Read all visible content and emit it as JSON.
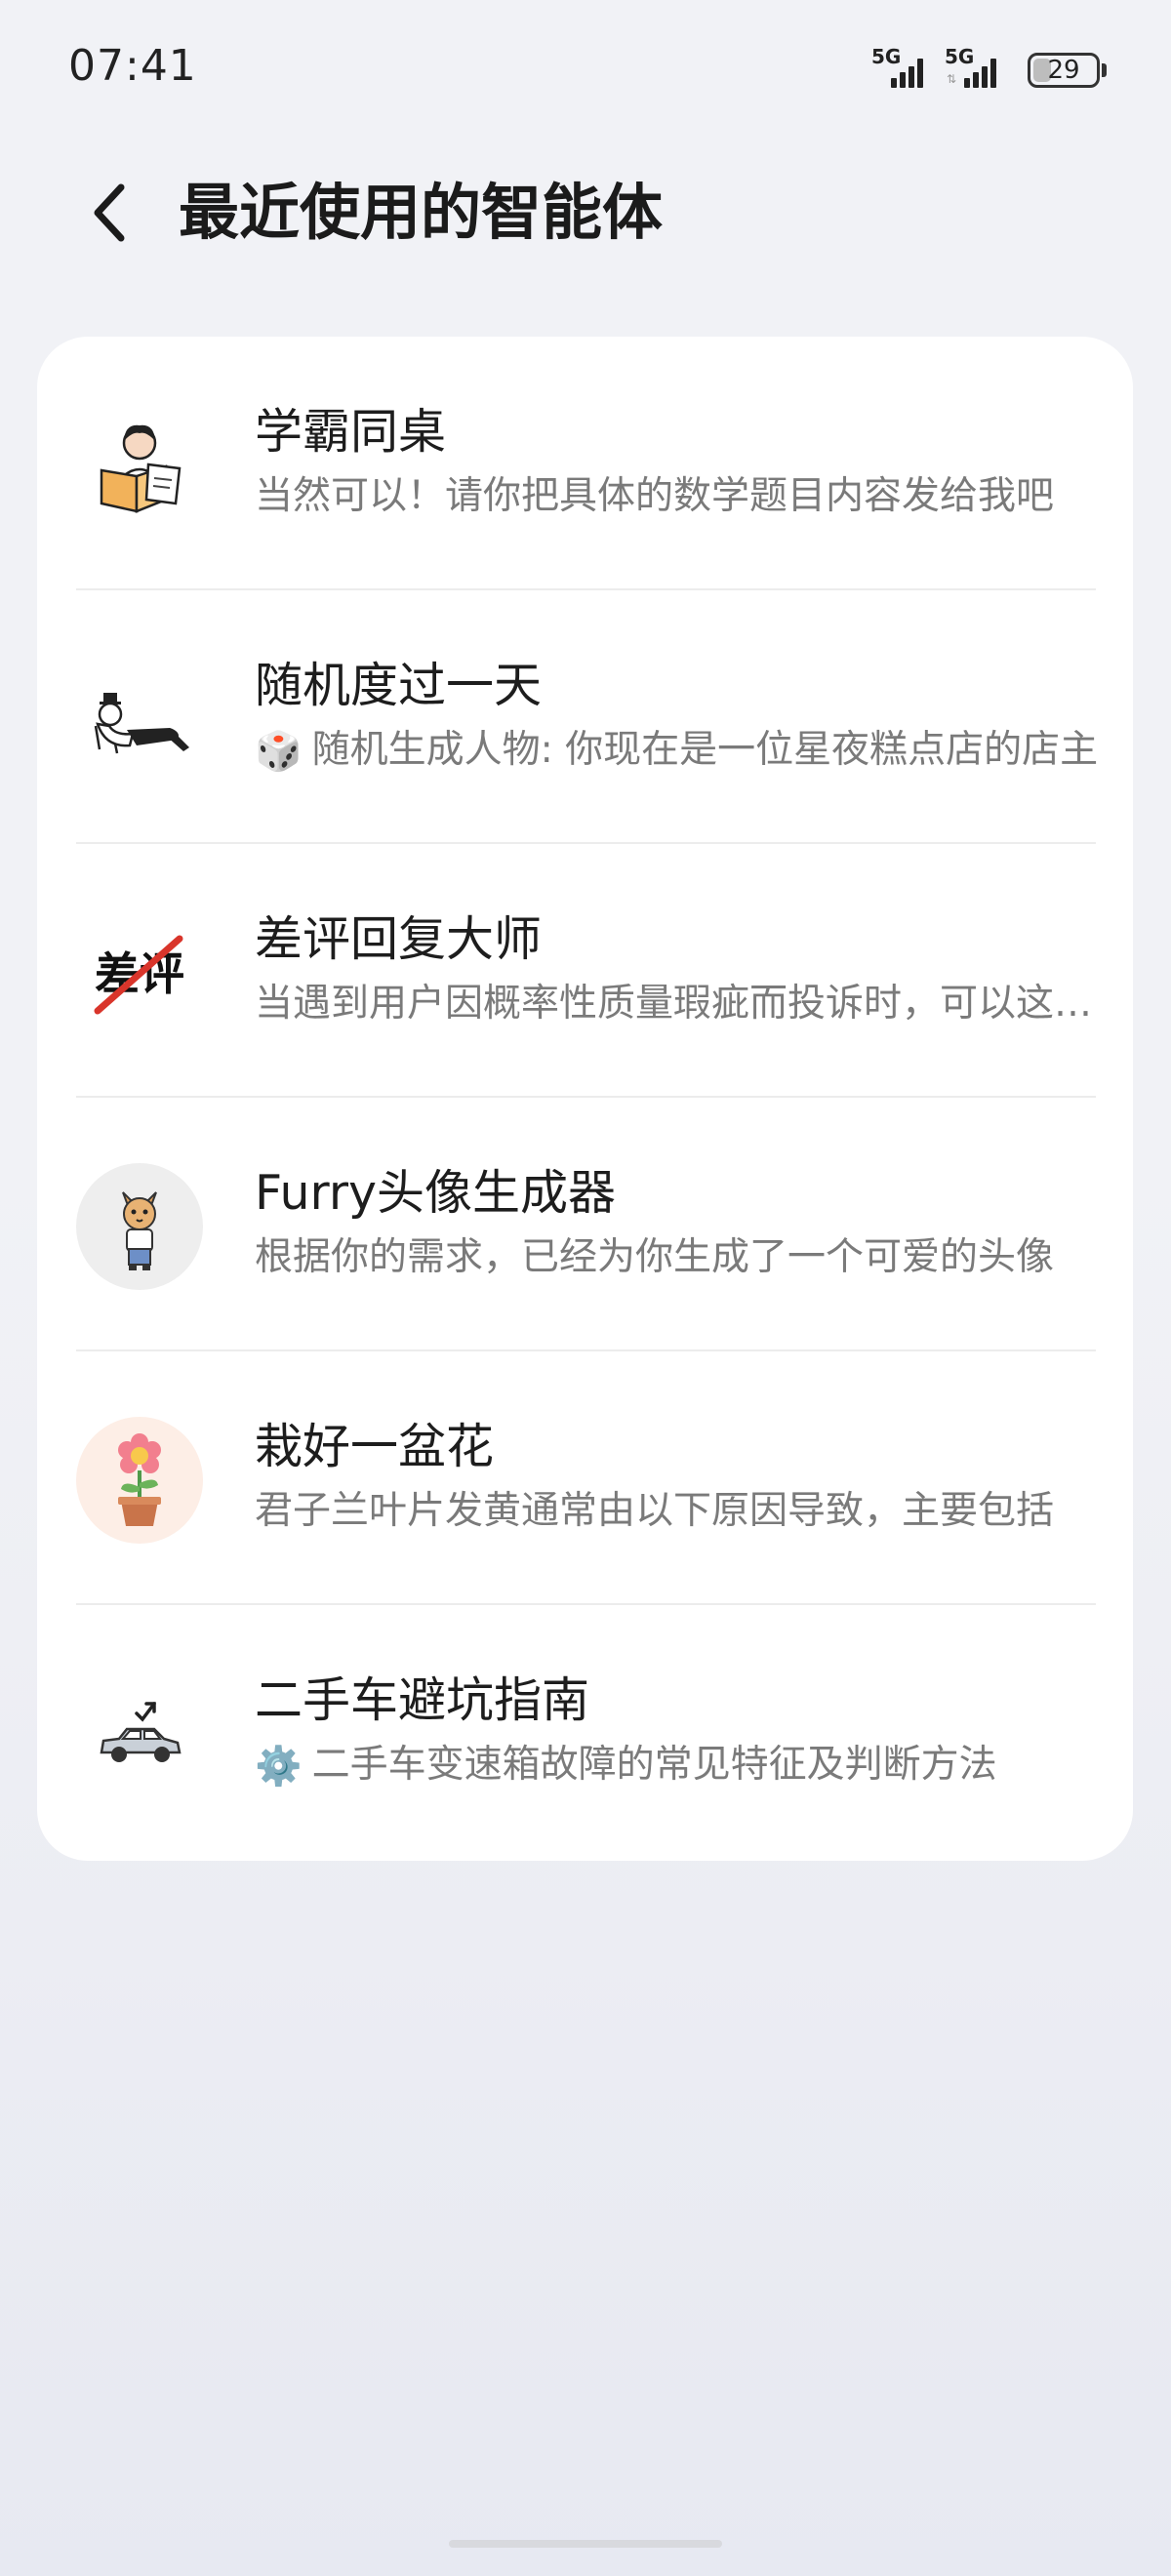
{
  "status_bar": {
    "time": "07:41",
    "signal1_label": "5G",
    "signal2_label": "5G",
    "battery": "29",
    "battery_level": 0.29
  },
  "header": {
    "title": "最近使用的智能体"
  },
  "agents": [
    {
      "name": "学霸同桌",
      "desc": "当然可以！请你把具体的数学题目内容发给我吧",
      "icon": "student-reading-icon"
    },
    {
      "name": "随机度过一天",
      "desc": "随机生成人物: 你现在是一位星夜糕点店的店主",
      "desc_emoji": "🎲",
      "icon": "lying-character-icon"
    },
    {
      "name": "差评回复大师",
      "desc": "当遇到用户因概率性质量瑕疵而投诉时，可以这样回复",
      "icon": "bad-review-icon"
    },
    {
      "name": "Furry头像生成器",
      "desc": "根据你的需求，已经为你生成了一个可爱的头像",
      "icon": "furry-cat-icon"
    },
    {
      "name": "栽好一盆花",
      "desc": "君子兰叶片发黄通常由以下原因导致，主要包括",
      "icon": "flower-pot-icon"
    },
    {
      "name": "二手车避坑指南",
      "desc": "二手车变速箱故障的常见特征及判断方法",
      "desc_emoji": "⚙️",
      "icon": "used-car-icon"
    }
  ],
  "colors": {
    "background": "#f1f2f6",
    "card": "#ffffff",
    "title_text": "#1b1b1b",
    "desc_text": "#7a7a7a",
    "accent_red": "#d9352b"
  }
}
